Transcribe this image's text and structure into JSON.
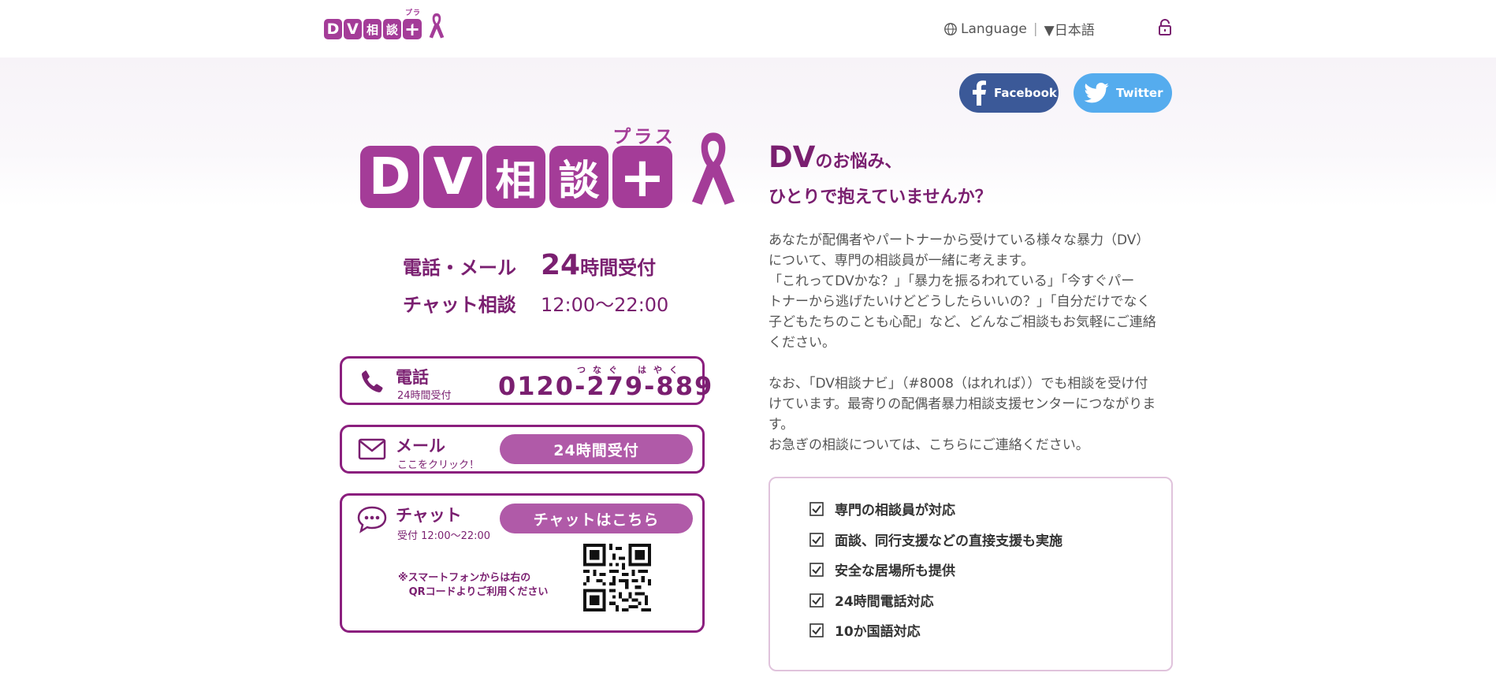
{
  "header": {
    "logo": {
      "tiles": [
        "D",
        "V",
        "相",
        "談"
      ],
      "plus_kana": "プラス"
    },
    "language_label": "Language",
    "language_selected": "▼日本語"
  },
  "social": {
    "facebook": "Facebook",
    "twitter": "Twitter"
  },
  "hero_logo": {
    "tiles": [
      "D",
      "V",
      "相",
      "談"
    ],
    "plus_kana": "プラス"
  },
  "hours": {
    "phone_mail_label": "電話・メール",
    "phone_mail_num": "24",
    "phone_mail_rest": "時間受付",
    "chat_label": "チャット相談",
    "chat_time": "12:00〜22:00"
  },
  "phone_box": {
    "title": "電話",
    "sub": "24時間受付",
    "number": "0120-279-889",
    "ruby_left": "つなぐ",
    "ruby_right": "はやく"
  },
  "mail_box": {
    "title": "メール",
    "sub": "ここをクリック！",
    "button": "24時間受付"
  },
  "chat_box": {
    "title": "チャット",
    "sub": "受付 12:00〜22:00",
    "button": "チャットはこちら",
    "note": "※スマートフォンからは右の\n   QRコードよりご利用ください"
  },
  "headline": {
    "line1_big": "DV",
    "line1_rest": "のお悩み、",
    "line2": "ひとりで抱えていませんか？"
  },
  "paragraph1": "あなたが配偶者やパートナーから受けている様々な暴力（DV）\nについて、専門の相談員が一緒に考えます。\n「これってDVかな？」「暴力を振るわれている」「今すぐパー\nトナーから逃げたいけどどうしたらいいの？」「自分だけでなく\n子どもたちのことも心配」など、どんなご相談もお気軽にご連絡\nください。",
  "paragraph2": "なお、「DV相談ナビ」（#8008（はれれば））でも相談を受け付\nけています。最寄りの配偶者暴力相談支援センターにつながりま\nす。\nお急ぎの相談については、こちらにご連絡ください。",
  "features": [
    "専門の相談員が対応",
    "面談、同行支援などの直接支援も実施",
    "安全な居場所も提供",
    "24時間電話対応",
    "10か国語対応"
  ],
  "colors": {
    "brand": "#a43c98",
    "text_brand": "#7a1f70",
    "facebook": "#3b5998",
    "twitter": "#55acee"
  }
}
